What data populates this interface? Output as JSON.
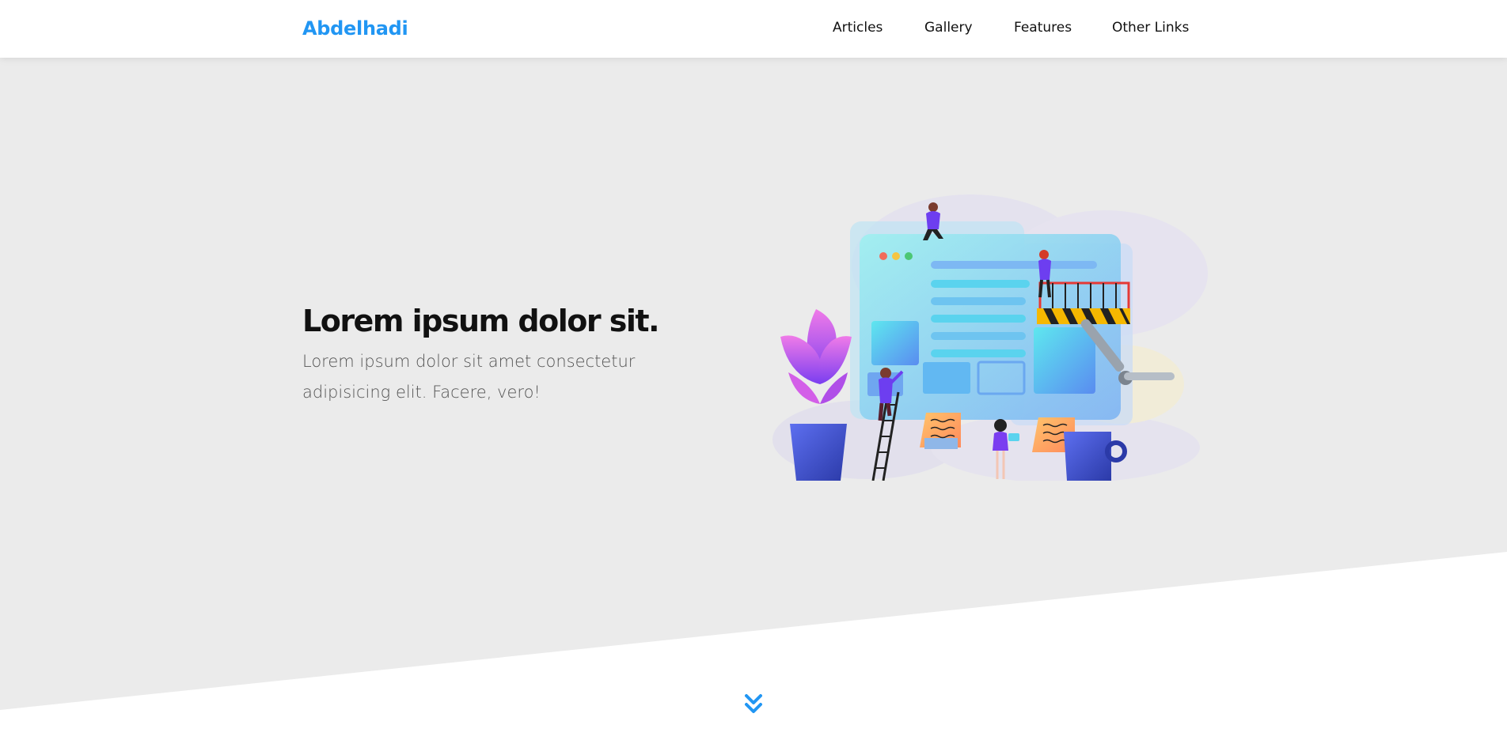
{
  "header": {
    "logo": "Abdelhadi",
    "nav": [
      {
        "label": "Articles"
      },
      {
        "label": "Gallery"
      },
      {
        "label": "Features"
      },
      {
        "label": "Other Links"
      }
    ]
  },
  "hero": {
    "title": "Lorem ipsum dolor sit.",
    "description": "Lorem ipsum dolor sit amet consectetur adipisicing elit. Facere, vero!",
    "illustration": "web-development-team-illustration"
  },
  "icons": {
    "go_down": "double-chevron-down-icon"
  },
  "colors": {
    "brand": "#2196f3",
    "hero_background": "#ebebeb",
    "text": "#111111",
    "muted_text": "#555555"
  }
}
